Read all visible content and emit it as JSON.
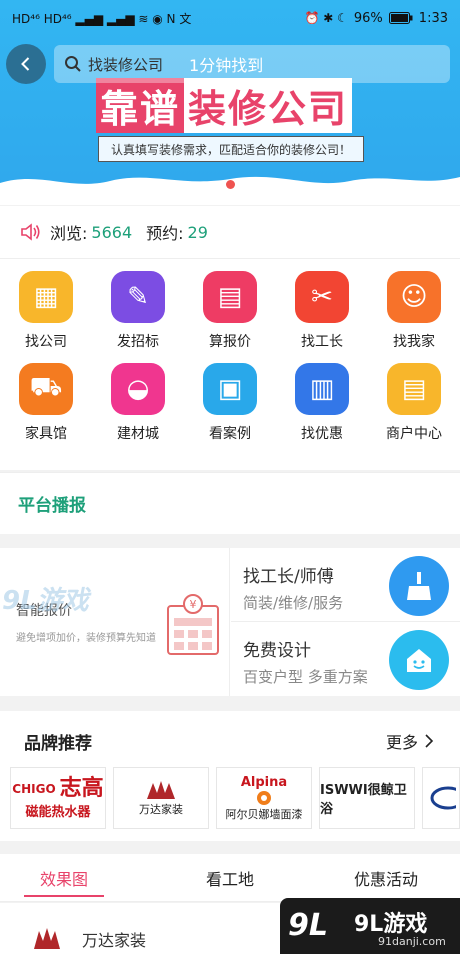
{
  "status_bar": {
    "left_icons": "HD⁴⁶ HD⁴⁶ ▂▄▆ ▂▄▆ ≋ ◉ N 文",
    "right_icons": "⏰ ✱ ☾",
    "battery": "96%",
    "time": "1:33"
  },
  "header": {
    "back_icon": "chevron-left-icon",
    "search_placeholder": "找装修公司",
    "search_slogan": "1分钟找到"
  },
  "hero": {
    "title_part1": "靠谱",
    "title_part2": "装修公司",
    "subtitle": "认真填写装修需求，匹配适合你的装修公司！"
  },
  "stats": {
    "views_label": "浏览:",
    "views_value": "5664",
    "bookings_label": "预约:",
    "bookings_value": "29"
  },
  "categories": [
    {
      "label": "找公司",
      "icon": "building-icon",
      "color": "#f8b62b",
      "glyph": "▦"
    },
    {
      "label": "发招标",
      "icon": "pen-ruler-icon",
      "color": "#7c4de3",
      "glyph": "✎"
    },
    {
      "label": "算报价",
      "icon": "calculator-icon",
      "color": "#ee3c64",
      "glyph": "▤"
    },
    {
      "label": "找工长",
      "icon": "tools-icon",
      "color": "#f24533",
      "glyph": "✂"
    },
    {
      "label": "找我家",
      "icon": "worker-icon",
      "color": "#f7722a",
      "glyph": "☺"
    },
    {
      "label": "家具馆",
      "icon": "cart-icon",
      "color": "#f47b20",
      "glyph": "⛟"
    },
    {
      "label": "建材城",
      "icon": "bathtub-icon",
      "color": "#f0368f",
      "glyph": "◒"
    },
    {
      "label": "看案例",
      "icon": "picture-icon",
      "color": "#29a8ea",
      "glyph": "▣"
    },
    {
      "label": "找优惠",
      "icon": "books-icon",
      "color": "#3377e8",
      "glyph": "▥"
    },
    {
      "label": "商户中心",
      "icon": "document-icon",
      "color": "#f8b62b",
      "glyph": "▤"
    }
  ],
  "broadcast": {
    "title": "平台播报"
  },
  "services": {
    "smart_quote_title": "智能报价",
    "smart_quote_desc": "避免增项加价，装修预算先知道",
    "foreman_title": "找工长/师傅",
    "foreman_desc": "简装/维修/服务",
    "design_title": "免费设计",
    "design_desc": "百变户型 多重方案"
  },
  "brands": {
    "title": "品牌推荐",
    "more": "更多",
    "items": [
      {
        "big": "志高",
        "small": "CHIGO",
        "text": "磁能热水器"
      },
      {
        "big": "",
        "small": "",
        "text": "万达家装"
      },
      {
        "big": "Alpina",
        "small": "",
        "text": "阿尔贝娜墙面漆"
      },
      {
        "big": "",
        "small": "",
        "text": "ISWWI很鲸卫浴"
      }
    ]
  },
  "tabs": [
    {
      "label": "效果图"
    },
    {
      "label": "看工地"
    },
    {
      "label": "优惠活动"
    }
  ],
  "list": {
    "company": "万达家装"
  },
  "watermark": {
    "brand": "9L游戏",
    "url": "91danji.com",
    "left_mark": "9L游戏"
  },
  "colors": {
    "hero_blue": "#33b6f2",
    "accent_pink": "#e8436a",
    "accent_green": "#1ea07a"
  }
}
